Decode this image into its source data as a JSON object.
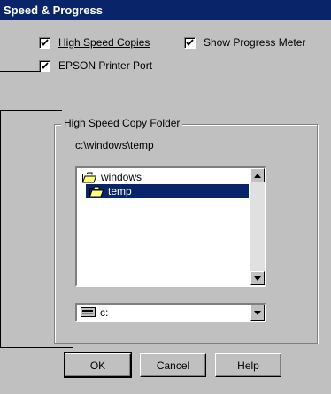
{
  "window": {
    "title": "Speed & Progress"
  },
  "options": {
    "high_speed_copies": {
      "label": "High Speed Copies",
      "checked": true
    },
    "show_progress_meter": {
      "label": "Show Progress Meter",
      "checked": true
    },
    "epson_printer_port": {
      "label": "EPSON Printer Port",
      "checked": true
    }
  },
  "folder_group": {
    "title": "High Speed Copy Folder",
    "current_path": "c:\\windows\\temp",
    "folders": [
      {
        "name": "windows",
        "icon": "open-folder-icon",
        "selected": false
      },
      {
        "name": "temp",
        "icon": "open-folder-icon",
        "selected": true
      }
    ],
    "drive": {
      "value": "c:",
      "icon": "drive-icon"
    }
  },
  "buttons": {
    "ok": "OK",
    "cancel": "Cancel",
    "help": "Help"
  },
  "colors": {
    "titlebar": "#0a246a",
    "selection": "#0a246a",
    "face": "#c0c0c0"
  }
}
